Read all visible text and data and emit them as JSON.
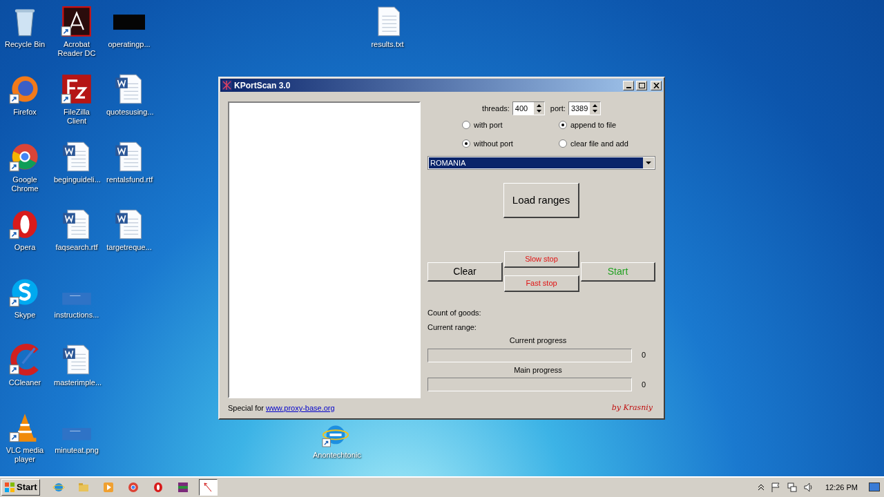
{
  "desktop_icons": [
    {
      "label": "Recycle Bin",
      "kind": "recycle",
      "shortcut": false
    },
    {
      "label": "Acrobat Reader DC",
      "kind": "acrobat",
      "shortcut": true
    },
    {
      "label": "operatingp...",
      "kind": "dark-thumb",
      "shortcut": false
    },
    {
      "label": "Firefox",
      "kind": "firefox",
      "shortcut": true
    },
    {
      "label": "FileZilla Client",
      "kind": "filezilla",
      "shortcut": true
    },
    {
      "label": "quotesusing...",
      "kind": "word",
      "shortcut": false
    },
    {
      "label": "Google Chrome",
      "kind": "chrome",
      "shortcut": true
    },
    {
      "label": "beginguideli...",
      "kind": "word",
      "shortcut": false
    },
    {
      "label": "rentalsfund.rtf",
      "kind": "word",
      "shortcut": false
    },
    {
      "label": "Opera",
      "kind": "opera",
      "shortcut": true
    },
    {
      "label": "faqsearch.rtf",
      "kind": "word",
      "shortcut": false
    },
    {
      "label": "targetreque...",
      "kind": "word",
      "shortcut": false
    },
    {
      "label": "Skype",
      "kind": "skype",
      "shortcut": true
    },
    {
      "label": "instructions...",
      "kind": "blank-thumb",
      "shortcut": false
    },
    {
      "label": "CCleaner",
      "kind": "ccleaner",
      "shortcut": true
    },
    {
      "label": "masterimple...",
      "kind": "word",
      "shortcut": false
    },
    {
      "label": "VLC media player",
      "kind": "vlc",
      "shortcut": true
    },
    {
      "label": "minuteat.png",
      "kind": "blank-thumb",
      "shortcut": false
    },
    {
      "label": "results.txt",
      "kind": "text",
      "shortcut": false
    },
    {
      "label": "Anontechtonic",
      "kind": "ie",
      "shortcut": true
    }
  ],
  "window": {
    "title": "KPortScan 3.0",
    "threads": {
      "label": "threads:",
      "value": "400"
    },
    "port": {
      "label": "port:",
      "value": "3389"
    },
    "radio_groups": [
      [
        {
          "label": "with port",
          "selected": false
        },
        {
          "label": "without port",
          "selected": true
        }
      ],
      [
        {
          "label": "append to file",
          "selected": true
        },
        {
          "label": "clear file and add",
          "selected": false
        }
      ]
    ],
    "country": {
      "value": "ROMANIA"
    },
    "load_button": "Load ranges",
    "clear_button": "Clear",
    "slow_stop_button": "Slow stop",
    "fast_stop_button": "Fast stop",
    "start_button": "Start",
    "count_label": "Count of goods:",
    "range_label": "Current range:",
    "progress": [
      {
        "label": "Current progress",
        "level": 0,
        "reading": "0"
      },
      {
        "label": "Main progress",
        "level": 0,
        "reading": "0"
      }
    ],
    "footer_text": "Special for",
    "footer_link": "www.proxy-base.org",
    "signature": "by Krasniy"
  },
  "taskbar": {
    "start": "Start",
    "items": [
      {
        "kind": "ie",
        "selected": false
      },
      {
        "kind": "folder",
        "selected": false
      },
      {
        "kind": "media",
        "selected": false
      },
      {
        "kind": "chrome",
        "selected": false
      },
      {
        "kind": "opera",
        "selected": false
      },
      {
        "kind": "archive",
        "selected": false
      },
      {
        "kind": "scanner",
        "selected": true
      }
    ],
    "clock": "12:26 PM"
  }
}
